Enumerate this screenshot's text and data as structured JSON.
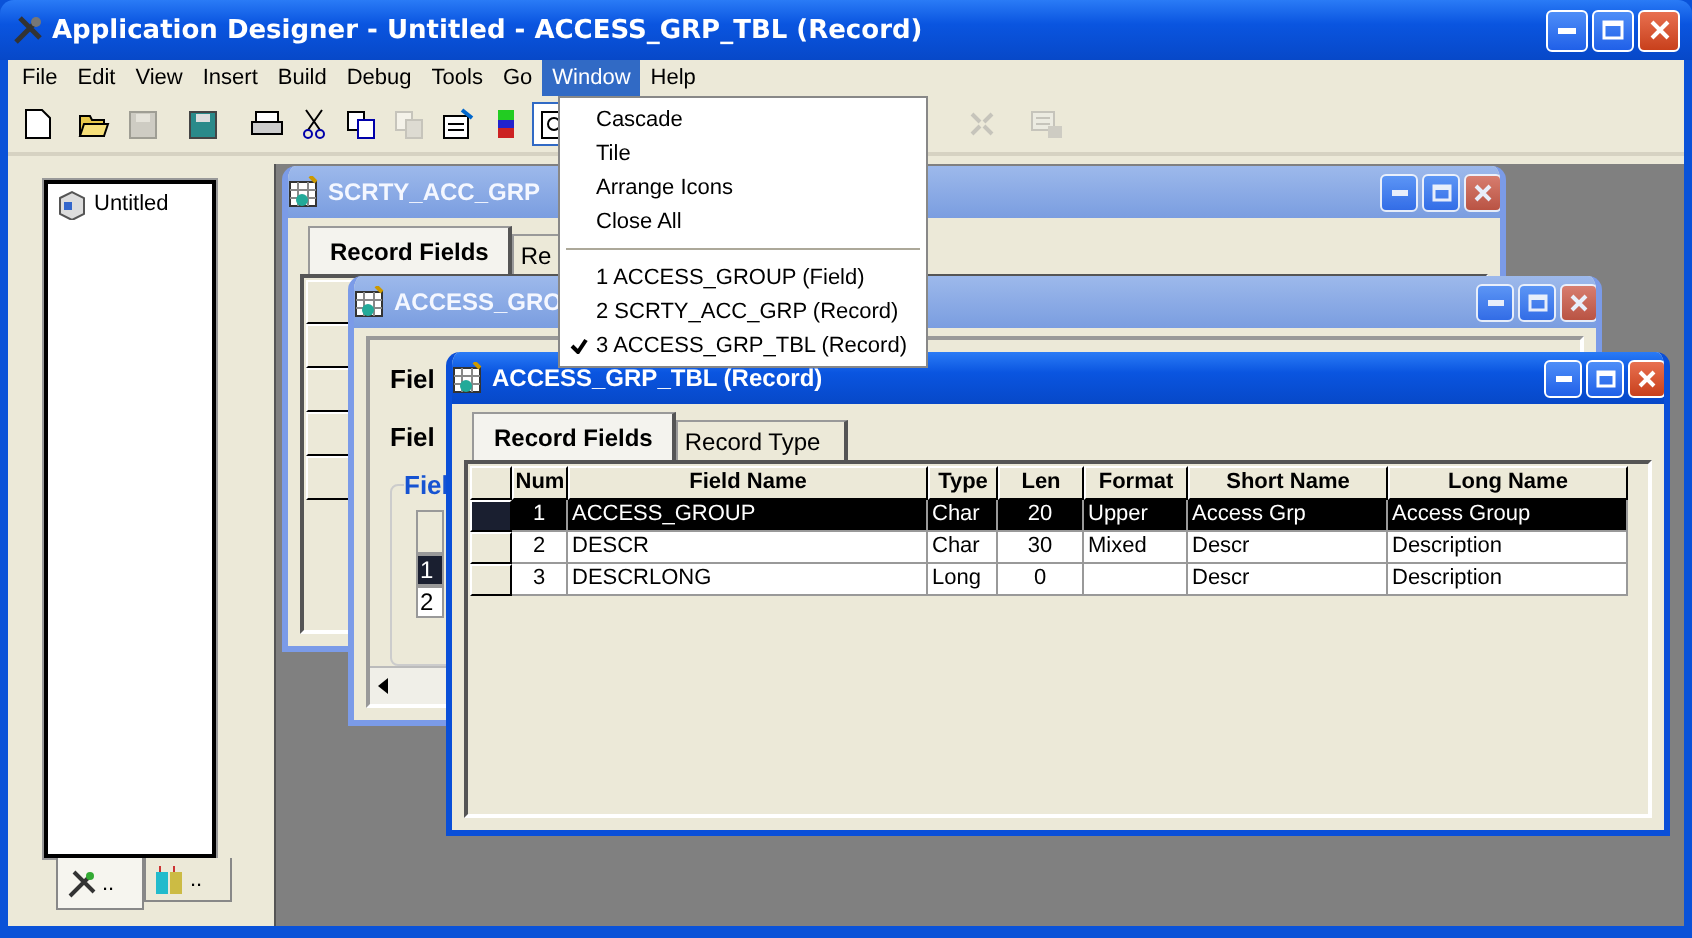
{
  "window": {
    "title": "Application Designer - Untitled - ACCESS_GRP_TBL (Record)"
  },
  "menu_bar": [
    {
      "label": "File",
      "selected": false
    },
    {
      "label": "Edit",
      "selected": false
    },
    {
      "label": "View",
      "selected": false
    },
    {
      "label": "Insert",
      "selected": false
    },
    {
      "label": "Build",
      "selected": false
    },
    {
      "label": "Debug",
      "selected": false
    },
    {
      "label": "Tools",
      "selected": false
    },
    {
      "label": "Go",
      "selected": false
    },
    {
      "label": "Window",
      "selected": true
    },
    {
      "label": "Help",
      "selected": false
    }
  ],
  "window_menu": {
    "items": [
      {
        "kind": "item",
        "label": "Cascade",
        "checked": false
      },
      {
        "kind": "item",
        "label": "Tile",
        "checked": false
      },
      {
        "kind": "item",
        "label": "Arrange Icons",
        "checked": false
      },
      {
        "kind": "item",
        "label": "Close All",
        "checked": false
      },
      {
        "kind": "separator"
      },
      {
        "kind": "item",
        "label": "1 ACCESS_GROUP (Field)",
        "checked": false
      },
      {
        "kind": "item",
        "label": "2 SCRTY_ACC_GRP (Record)",
        "checked": false
      },
      {
        "kind": "item",
        "label": "3 ACCESS_GRP_TBL (Record)",
        "checked": true
      }
    ]
  },
  "toolbar": [
    {
      "disabled": false
    },
    {
      "disabled": false
    },
    {
      "disabled": true
    },
    {
      "disabled": false
    },
    {
      "disabled": false
    },
    {
      "disabled": false
    },
    {
      "disabled": false
    },
    {
      "disabled": true
    },
    {
      "disabled": false
    },
    {
      "disabled": false
    },
    {
      "disabled": false
    },
    {
      "disabled": true
    },
    {
      "disabled": true
    }
  ],
  "project": {
    "items": [
      {
        "label": "Untitled"
      }
    ],
    "tabs": [
      {
        "label": "..",
        "selected": true
      },
      {
        "label": "..",
        "selected": false
      }
    ]
  },
  "documents": [
    {
      "kind": "grid",
      "title": "SCRTY_ACC_GRP",
      "active": false,
      "tabs": [
        {
          "label": "Record Fields",
          "selected": true
        },
        {
          "label": "Re",
          "selected": false
        }
      ]
    },
    {
      "kind": "field",
      "title": "ACCESS_GRO",
      "active": false,
      "labels": [
        "Fiel",
        "Fiel"
      ],
      "group": "Fiel",
      "rows": [
        {
          "label": "1",
          "selected": true
        },
        {
          "label": "2",
          "selected": false
        }
      ]
    },
    {
      "kind": "record",
      "title": "ACCESS_GRP_TBL (Record)",
      "active": true,
      "tabs": [
        {
          "label": "Record Fields",
          "selected": true
        },
        {
          "label": "Record Type",
          "selected": false
        }
      ],
      "columns": [
        "Num",
        "Field Name",
        "Type",
        "Len",
        "Format",
        "Short Name",
        "Long Name"
      ],
      "rows": [
        {
          "selected": true,
          "cells": [
            "1",
            "ACCESS_GROUP",
            "Char",
            "20",
            "Upper",
            "Access Grp",
            "Access Group"
          ]
        },
        {
          "selected": false,
          "cells": [
            "2",
            "DESCR",
            "Char",
            "30",
            "Mixed",
            "Descr",
            "Description"
          ]
        },
        {
          "selected": false,
          "cells": [
            "3",
            "DESCRLONG",
            "Long",
            "0",
            "",
            "Descr",
            "Description"
          ]
        }
      ]
    }
  ]
}
